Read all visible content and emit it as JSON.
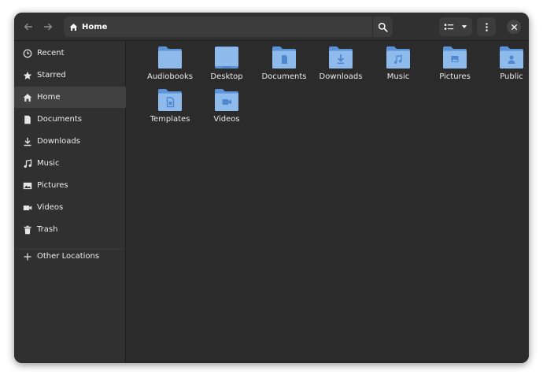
{
  "headerbar": {
    "location": "Home"
  },
  "sidebar": {
    "items": [
      {
        "label": "Recent",
        "icon": "clock-icon"
      },
      {
        "label": "Starred",
        "icon": "star-icon"
      },
      {
        "label": "Home",
        "icon": "home-icon",
        "active": true
      },
      {
        "label": "Documents",
        "icon": "document-icon"
      },
      {
        "label": "Downloads",
        "icon": "download-icon"
      },
      {
        "label": "Music",
        "icon": "music-note-icon"
      },
      {
        "label": "Pictures",
        "icon": "image-icon"
      },
      {
        "label": "Videos",
        "icon": "camera-icon"
      },
      {
        "label": "Trash",
        "icon": "trash-icon"
      }
    ],
    "other_locations": "Other Locations"
  },
  "files": [
    {
      "name": "Audiobooks",
      "emblem": "none"
    },
    {
      "name": "Desktop",
      "emblem": "desktop"
    },
    {
      "name": "Documents",
      "emblem": "document"
    },
    {
      "name": "Downloads",
      "emblem": "download"
    },
    {
      "name": "Music",
      "emblem": "music"
    },
    {
      "name": "Pictures",
      "emblem": "image"
    },
    {
      "name": "Public",
      "emblem": "person"
    },
    {
      "name": "Templates",
      "emblem": "template"
    },
    {
      "name": "Videos",
      "emblem": "video"
    }
  ],
  "colors": {
    "folder_back": "#5a93d8",
    "folder_front": "#8fbbec",
    "folder_emblem": "#4f88cf",
    "window_bg": "#2b2b2b",
    "sidebar_bg": "#303030",
    "active_bg": "#414141",
    "text": "#ececec"
  }
}
